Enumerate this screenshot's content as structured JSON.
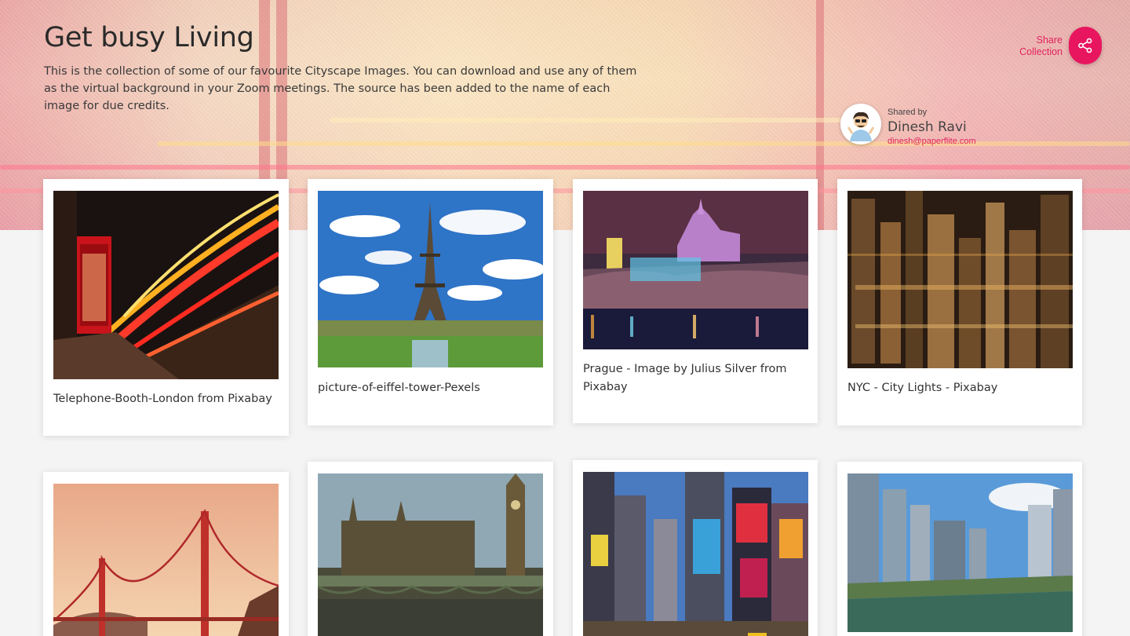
{
  "collection": {
    "title": "Get busy Living",
    "description": "This is the collection of some of our favourite Cityscape Images. You can download and use any of them as the virtual background in your Zoom meetings. The source has been added to the name of each image for due credits."
  },
  "share": {
    "label": "Share Collection",
    "icon": "share-icon",
    "accent_color": "#e8155f"
  },
  "sharer": {
    "shared_by_label": "Shared by",
    "name": "Dinesh Ravi",
    "email": "dinesh@paperflite.com"
  },
  "cards": [
    {
      "caption": "Telephone-Booth-London from Pixabay"
    },
    {
      "caption": "picture-of-eiffel-tower-Pexels"
    },
    {
      "caption": "Prague - Image by Julius Silver from Pixabay"
    },
    {
      "caption": "NYC - City Lights - Pixabay"
    },
    {
      "caption": ""
    },
    {
      "caption": ""
    },
    {
      "caption": ""
    },
    {
      "caption": ""
    }
  ]
}
